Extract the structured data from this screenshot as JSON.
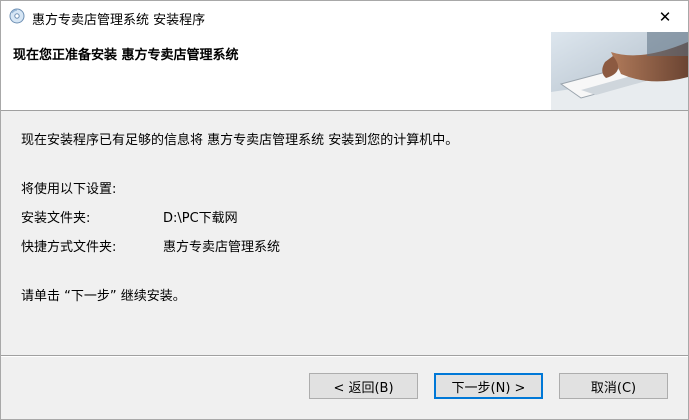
{
  "window": {
    "title": "惠方专卖店管理系统 安装程序",
    "close_glyph": "✕"
  },
  "header": {
    "title": "现在您正准备安装 惠方专卖店管理系统"
  },
  "main": {
    "intro": "现在安装程序已有足够的信息将 惠方专卖店管理系统 安装到您的计算机中。",
    "settings_heading": "将使用以下设置:",
    "settings": [
      {
        "label": "安装文件夹:",
        "value": "D:\\PC下载网"
      },
      {
        "label": "快捷方式文件夹:",
        "value": "惠方专卖店管理系统"
      }
    ],
    "instruction": "请单击 “下一步” 继续安装。"
  },
  "buttons": {
    "back": "< 返回(B)",
    "next": "下一步(N) >",
    "cancel": "取消(C)"
  },
  "colors": {
    "focus_border": "#0078d7",
    "button_face": "#e1e1e1",
    "dialog_bg": "#f0f0f0"
  }
}
